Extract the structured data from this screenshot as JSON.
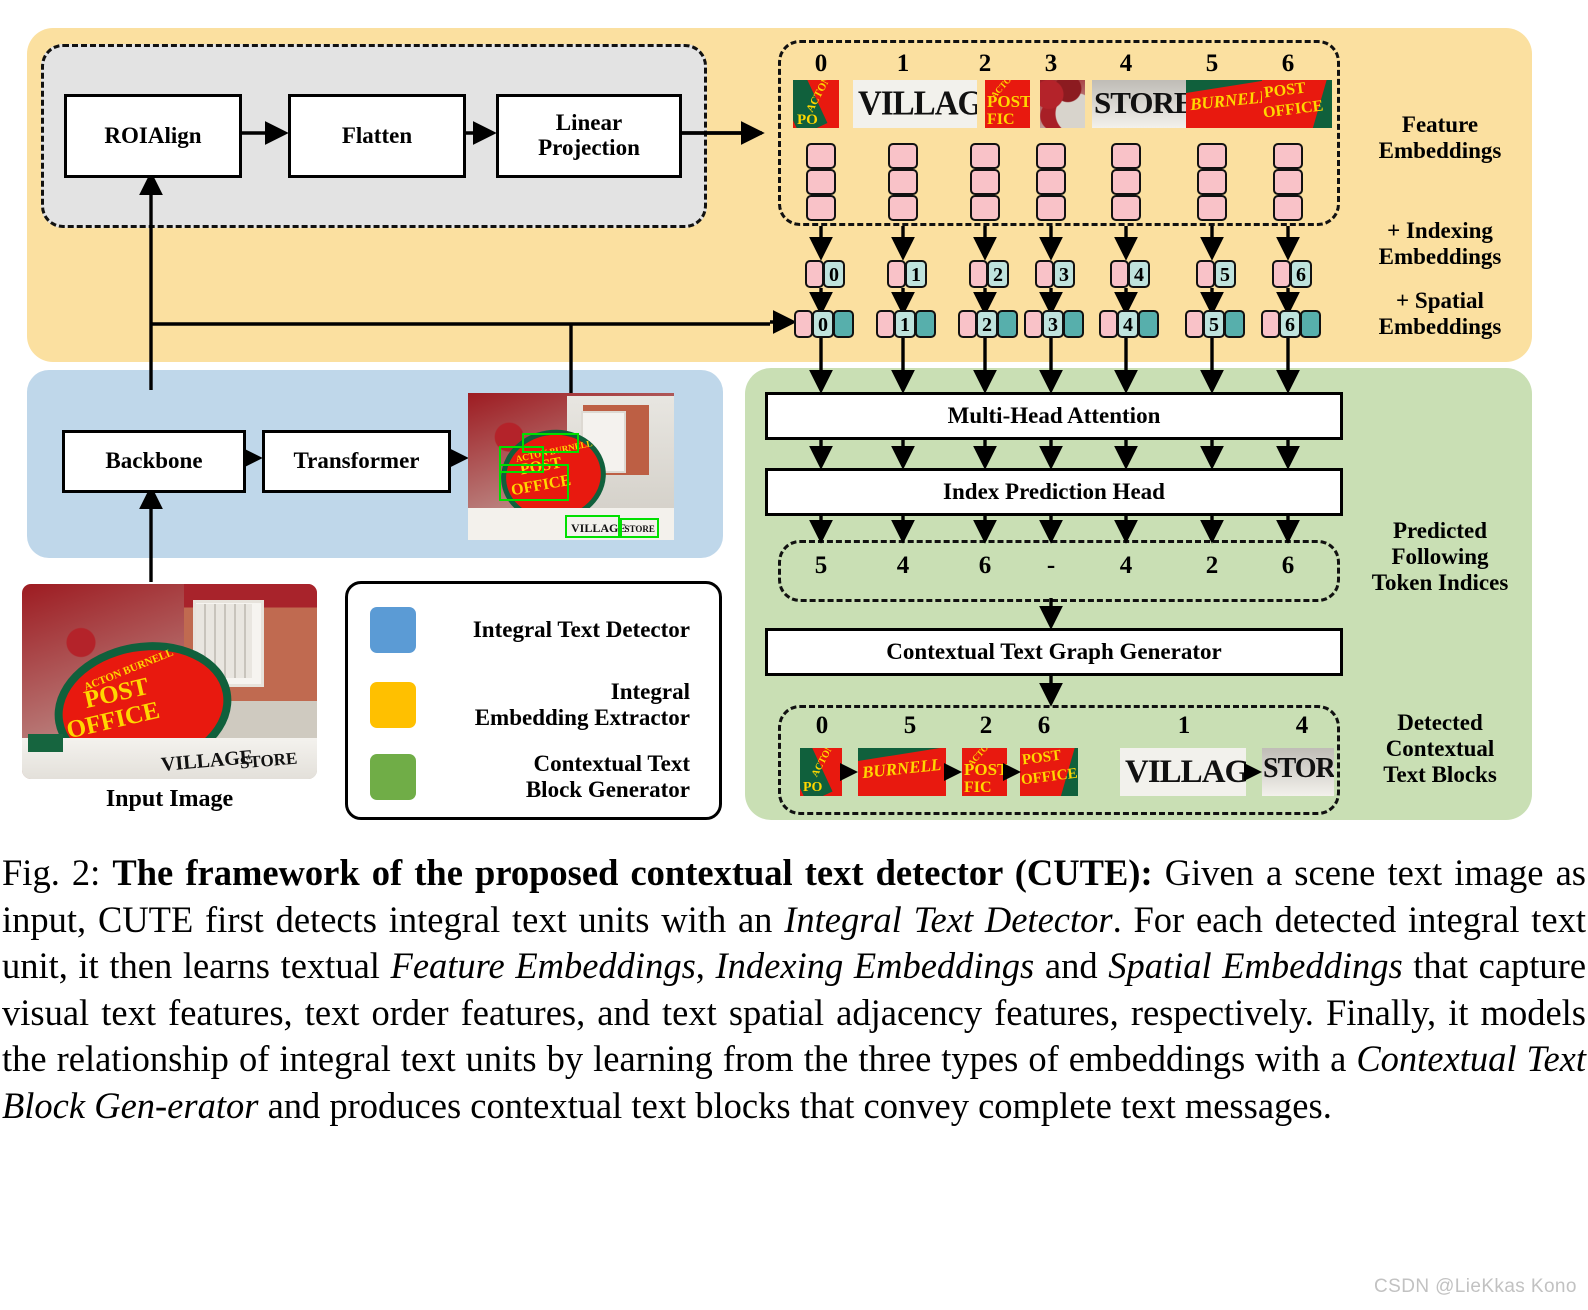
{
  "figure": {
    "panels": {
      "integral_embedding_extractor_color": "#fbe0a0",
      "integral_text_detector_color": "#bfd7ea",
      "contextual_text_block_generator_color": "#c9dfb4"
    },
    "extractor_boxes": [
      {
        "label": "ROIAlign"
      },
      {
        "label": "Flatten"
      },
      {
        "label": "Linear\nProjection"
      }
    ],
    "extractor_box_labels": {
      "roialign": "ROIAlign",
      "flatten": "Flatten",
      "linear_projection_line1": "Linear",
      "linear_projection_line2": "Projection"
    },
    "detector_boxes": {
      "backbone": "Backbone",
      "transformer": "Transformer"
    },
    "generator_boxes": {
      "multi_head_attention": "Multi-Head Attention",
      "index_prediction_head": "Index Prediction Head",
      "contextual_text_graph_generator": "Contextual Text Graph Generator"
    },
    "side_labels": {
      "feature_embeddings_line1": "Feature",
      "feature_embeddings_line2": "Embeddings",
      "indexing_embeddings_line1": "+ Indexing",
      "indexing_embeddings_line2": "Embeddings",
      "spatial_embeddings_line1": "+ Spatial",
      "spatial_embeddings_line2": "Embeddings",
      "predicted_indices_line1": "Predicted",
      "predicted_indices_line2": "Following",
      "predicted_indices_line3": "Token Indices",
      "detected_blocks_line1": "Detected",
      "detected_blocks_line2": "Contextual",
      "detected_blocks_line3": "Text Blocks"
    },
    "tokens": [
      {
        "index": "0",
        "text": "ACTON",
        "kind": "red"
      },
      {
        "index": "1",
        "text": "VILLAGE",
        "kind": "white"
      },
      {
        "index": "2",
        "text": "POST",
        "kind": "red"
      },
      {
        "index": "3",
        "text": "",
        "kind": "leaf"
      },
      {
        "index": "4",
        "text": "STORE",
        "kind": "white"
      },
      {
        "index": "5",
        "text": "BURNELL",
        "kind": "red"
      },
      {
        "index": "6",
        "text": "OFFICE",
        "kind": "red"
      }
    ],
    "indexing_row_values": [
      "0",
      "1",
      "2",
      "3",
      "4",
      "5",
      "6"
    ],
    "spatial_row_values": [
      "0",
      "1",
      "2",
      "3",
      "4",
      "5",
      "6"
    ],
    "predicted_following_token_indices": [
      "5",
      "4",
      "6",
      "-",
      "4",
      "2",
      "6"
    ],
    "detected_text_blocks": [
      {
        "indices": [
          "0",
          "5",
          "2",
          "6"
        ],
        "texts": [
          "ACTON",
          "BURNELL",
          "POST",
          "OFFICE"
        ]
      },
      {
        "indices": [
          "1",
          "4"
        ],
        "texts": [
          "VILLAGE",
          "STORE"
        ]
      }
    ],
    "legend": [
      {
        "color": "#5b9bd5",
        "label_line1": "Integral Text Detector",
        "label_line2": ""
      },
      {
        "color": "#ffc000",
        "label_line1": "Integral",
        "label_line2": "Embedding Extractor"
      },
      {
        "color": "#70ad47",
        "label_line1": "Contextual Text",
        "label_line2": "Block Generator"
      }
    ],
    "input_image_label": "Input Image",
    "scene_text": {
      "sign_line1": "ACTON BURNELL",
      "sign_line2": "POST",
      "sign_line3": "OFFICE",
      "shop_sign": "VILLAGE STORE"
    },
    "colors": {
      "feature_embedding": "#f9c2c8",
      "indexing_embedding": "#bfe3dd",
      "spatial_embedding": "#57afac",
      "detection_box": "#00e000"
    }
  },
  "caption": {
    "figure_number": "Fig. 2: ",
    "bold_title": "The framework of the proposed contextual text detector (CUTE):",
    "body_1": " Given a scene text image as input, CUTE first detects integral text units with an ",
    "italic_1": "Integral Text Detector",
    "body_2": ". For each detected integral text unit, it then learns textual ",
    "italic_2": "Feature Embeddings",
    "body_3": ", ",
    "italic_3": "Indexing Embeddings",
    "body_4": " and ",
    "italic_4": "Spatial Embeddings",
    "body_5": " that capture visual text features, text order features, and text spatial adjacency features, respectively. Finally, it models the relationship of integral text units by learning from the three types of embeddings with a ",
    "italic_5": "Contextual Text Block Gen-erator",
    "body_6": " and produces contextual text blocks that convey complete text messages."
  },
  "watermark": "CSDN @LieKkas Kono"
}
